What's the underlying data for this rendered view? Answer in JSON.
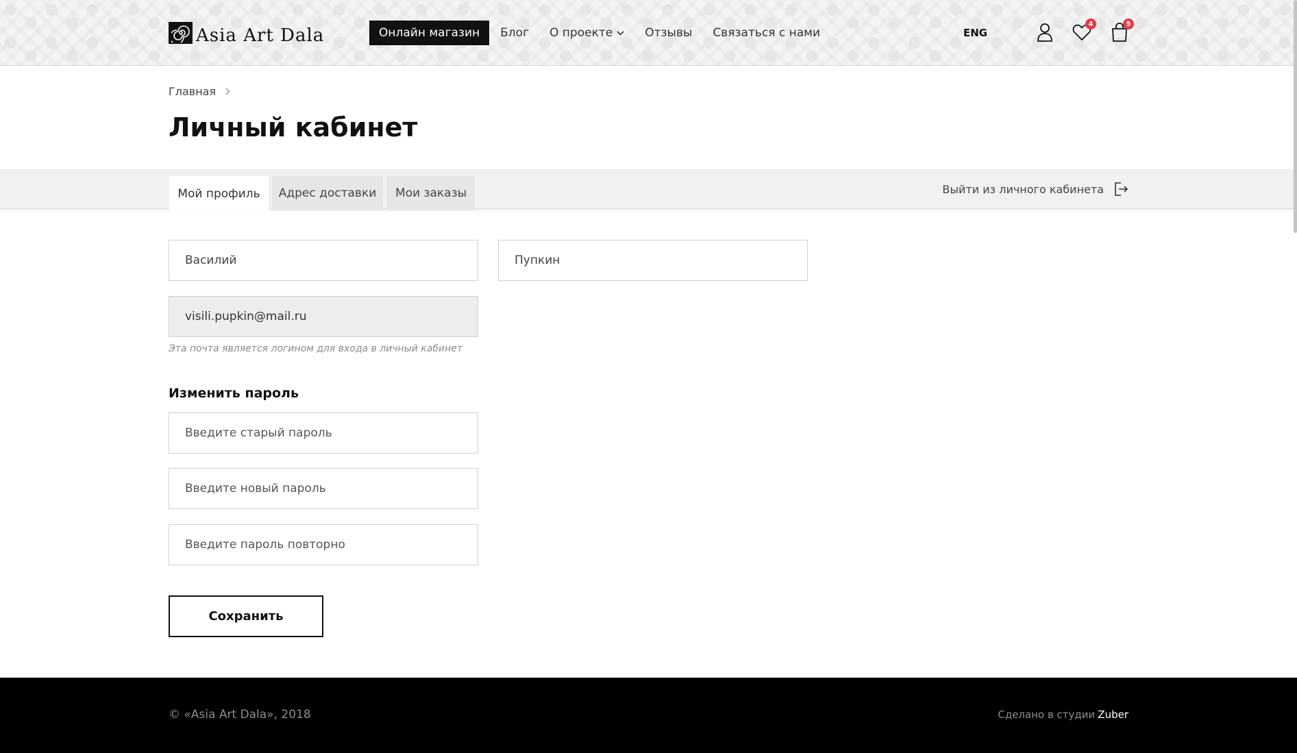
{
  "header": {
    "logo_text": "Asia Art Dala",
    "nav": [
      {
        "label": "Онлайн магазин",
        "active": true
      },
      {
        "label": "Блог"
      },
      {
        "label": "О проекте",
        "has_dropdown": true
      },
      {
        "label": "Отзывы"
      },
      {
        "label": "Связаться с нами"
      }
    ],
    "lang": "ENG",
    "favorites_count": "4",
    "cart_count": "5",
    "icons": {
      "account": "user-icon",
      "favorites": "heart-icon",
      "cart": "shopping-bag-icon",
      "dropdown": "chevron-down-icon"
    }
  },
  "breadcrumb": {
    "home": "Главная"
  },
  "page_title": "Личный кабинет",
  "tabs": [
    {
      "label": "Мой профиль",
      "active": true
    },
    {
      "label": "Адрес доставки"
    },
    {
      "label": "Мои заказы"
    }
  ],
  "logout_label": "Выйти из личного кабинета",
  "profile": {
    "first_name": "Василий",
    "last_name": "Пупкин",
    "email": "visili.pupkin@mail.ru",
    "email_hint": "Эта почта является логином для входа в личный кабинет"
  },
  "password": {
    "title": "Изменить пароль",
    "old_placeholder": "Введите старый пароль",
    "new_placeholder": "Введите новый пароль",
    "repeat_placeholder": "Введите пароль повторно"
  },
  "save_label": "Сохранить",
  "footer": {
    "copyright": "© «Asia Art Dala», 2018",
    "studio_prefix": "Сделано в студии",
    "studio_name": "Zuber"
  },
  "colors": {
    "accent": "#111111",
    "badge": "#e53945",
    "tabs_bg": "#f1f1f2",
    "footer_bg": "#000000"
  }
}
